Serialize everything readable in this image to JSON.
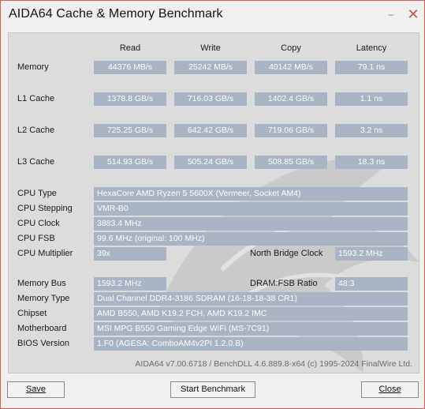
{
  "window": {
    "title": "AIDA64 Cache & Memory Benchmark",
    "minimize_glyph": "–",
    "close_glyph": "✕"
  },
  "columns": [
    "Read",
    "Write",
    "Copy",
    "Latency"
  ],
  "bench_rows": [
    {
      "label": "Memory",
      "values": [
        "44376 MB/s",
        "25242 MB/s",
        "40142 MB/s",
        "79.1 ns"
      ]
    },
    {
      "label": "L1 Cache",
      "values": [
        "1378.8 GB/s",
        "716.03 GB/s",
        "1402.4 GB/s",
        "1.1 ns"
      ]
    },
    {
      "label": "L2 Cache",
      "values": [
        "725.25 GB/s",
        "642.42 GB/s",
        "719.06 GB/s",
        "3.2 ns"
      ]
    },
    {
      "label": "L3 Cache",
      "values": [
        "514.93 GB/s",
        "505.24 GB/s",
        "508.85 GB/s",
        "18.3 ns"
      ]
    }
  ],
  "cpu": {
    "type": {
      "label": "CPU Type",
      "value": "HexaCore AMD Ryzen 5 5600X  (Vermeer, Socket AM4)"
    },
    "stepping": {
      "label": "CPU Stepping",
      "value": "VMR-B0"
    },
    "clock": {
      "label": "CPU Clock",
      "value": "3883.4 MHz"
    },
    "fsb": {
      "label": "CPU FSB",
      "value": "99.6 MHz  (original: 100 MHz)"
    },
    "multiplier": {
      "label": "CPU Multiplier",
      "value": "39x"
    },
    "nb_clock": {
      "label": "North Bridge Clock",
      "value": "1593.2 MHz"
    }
  },
  "memory": {
    "bus": {
      "label": "Memory Bus",
      "value": "1593.2 MHz"
    },
    "ratio": {
      "label": "DRAM:FSB Ratio",
      "value": "48:3"
    },
    "type": {
      "label": "Memory Type",
      "value": "Dual Channel DDR4-3186 SDRAM  (16-18-18-38 CR1)"
    },
    "chipset": {
      "label": "Chipset",
      "value": "AMD B550, AMD K19.2 FCH, AMD K19.2 IMC"
    },
    "motherboard": {
      "label": "Motherboard",
      "value": "MSI MPG B550 Gaming Edge WiFi (MS-7C91)"
    },
    "bios": {
      "label": "BIOS Version",
      "value": "1.F0  (AGESA: ComboAM4v2PI 1.2.0.B)"
    }
  },
  "footer": {
    "info": "AIDA64 v7.00.6718 / BenchDLL 4.6.889.8-x64  (c) 1995-2024 FinalWire Ltd."
  },
  "buttons": {
    "save": "Save",
    "start": "Start Benchmark",
    "close": "Close"
  },
  "colors": {
    "value_box": "#a8b3c4",
    "panel": "#dcdcdc",
    "border_accent": "#e05a55"
  }
}
